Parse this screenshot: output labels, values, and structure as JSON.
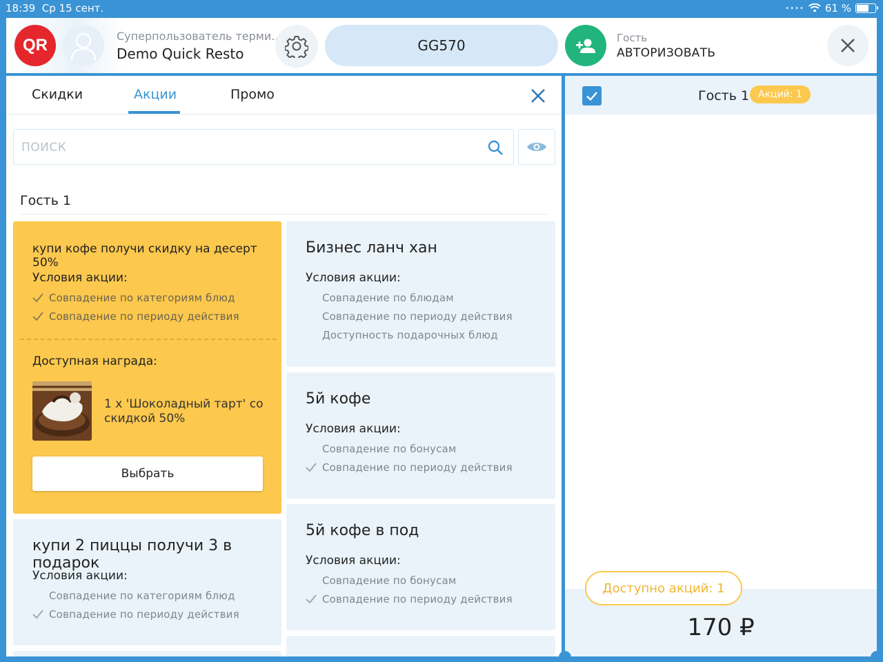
{
  "status_bar": {
    "time": "18:39",
    "date": "Ср 15 сент.",
    "battery": "61 %",
    "battery_level": 0.61
  },
  "header": {
    "logo_text": "QR",
    "user_role": "Суперпользователь терми...",
    "user_name": "Demo Quick Resto",
    "order_code": "GG570",
    "guest_label": "Гость",
    "guest_action": "АВТОРИЗОВАТЬ"
  },
  "tabs": [
    {
      "label": "Скидки",
      "active": false
    },
    {
      "label": "Акции",
      "active": true
    },
    {
      "label": "Промо",
      "active": false
    }
  ],
  "search": {
    "placeholder": "ПОИСК"
  },
  "section": {
    "title": "Гость 1"
  },
  "cards": [
    {
      "title": "купи кофе получи скидку на десерт 50%",
      "highlighted": true,
      "conditions_label": "Условия акции:",
      "conditions": [
        {
          "text": "Совпадение по категориям блюд",
          "matched": true
        },
        {
          "text": "Совпадение по периоду действия",
          "matched": true
        }
      ],
      "reward_label": "Доступная награда:",
      "reward_text": "1 x 'Шоколадный тарт' со скидкой 50%",
      "button": "Выбрать"
    },
    {
      "title": "Бизнес ланч хан",
      "conditions_label": "Условия акции:",
      "conditions": [
        {
          "text": "Совпадение по блюдам",
          "matched": false
        },
        {
          "text": "Совпадение по периоду действия",
          "matched": false
        },
        {
          "text": "Доступность подарочных блюд",
          "matched": false
        }
      ]
    },
    {
      "title": "5й кофе",
      "conditions_label": "Условия акции:",
      "conditions": [
        {
          "text": "Совпадение по бонусам",
          "matched": false
        },
        {
          "text": "Совпадение по периоду действия",
          "matched": true
        }
      ]
    },
    {
      "title": "купи 2 пиццы получи 3 в подарок",
      "conditions_label": "Условия акции:",
      "conditions": [
        {
          "text": "Совпадение по категориям блюд",
          "matched": false
        },
        {
          "text": "Совпадение по периоду действия",
          "matched": true
        }
      ]
    },
    {
      "title": "5й кофе в под",
      "conditions_label": "Условия акции:",
      "conditions": [
        {
          "text": "Совпадение по бонусам",
          "matched": false
        },
        {
          "text": "Совпадение по периоду действия",
          "matched": true
        }
      ]
    }
  ],
  "right_panel": {
    "guest": "Гость 1",
    "badge": "Акций: 1",
    "available": "Доступно акций: 1",
    "total": "170 ₽"
  },
  "colors": {
    "accent": "#3a93d4",
    "highlight": "#fcc84d",
    "guest_button": "#21b57d",
    "logo": "#e5262d"
  }
}
